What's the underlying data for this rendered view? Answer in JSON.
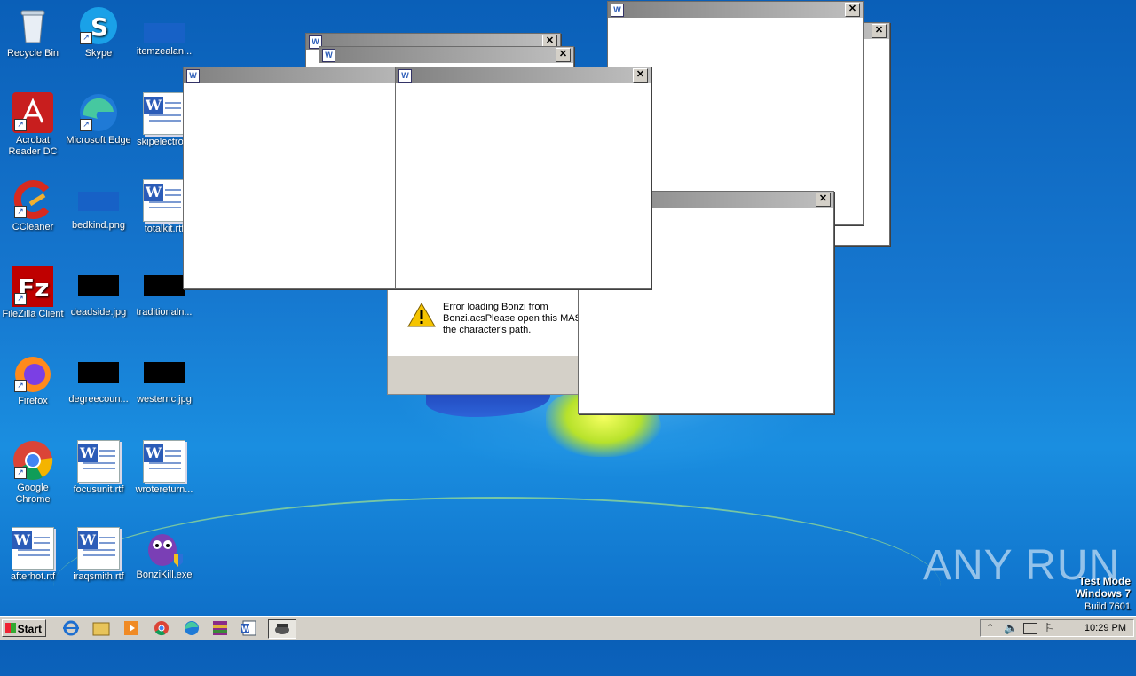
{
  "desktop_icons": [
    {
      "label": "Recycle Bin"
    },
    {
      "label": "Skype"
    },
    {
      "label": "itemzealan..."
    },
    {
      "label": "Acrobat Reader DC"
    },
    {
      "label": "Microsoft Edge"
    },
    {
      "label": "skipelectro..."
    },
    {
      "label": "CCleaner"
    },
    {
      "label": "bedkind.png"
    },
    {
      "label": "totalkit.rtf"
    },
    {
      "label": "FileZilla Client"
    },
    {
      "label": "deadside.jpg"
    },
    {
      "label": "traditionaln..."
    },
    {
      "label": "Firefox"
    },
    {
      "label": "degreecoun..."
    },
    {
      "label": "westernc.jpg"
    },
    {
      "label": "Google Chrome"
    },
    {
      "label": "focusunit.rtf"
    },
    {
      "label": "wrotereturn..."
    },
    {
      "label": "afterhot.rtf"
    },
    {
      "label": "iraqsmith.rtf"
    },
    {
      "label": "BonziKill.exe"
    }
  ],
  "error_dialog": {
    "message": "Error loading Bonzi from Bonzi.acsPlease open this MASH the character's path."
  },
  "windows": {
    "close_glyph": "✕"
  },
  "taskbar": {
    "start_label": "Start",
    "clock": "10:29 PM"
  },
  "watermark": {
    "line1": "Test Mode",
    "line2": "Windows 7",
    "line3": "Build 7601",
    "brand": "ANY RUN"
  },
  "colors": {
    "desktop_bg": "#1677cf",
    "titlebar_dark": "#808080",
    "titlebar_light": "#c0c0c0",
    "taskbar": "#d4d0c8"
  }
}
